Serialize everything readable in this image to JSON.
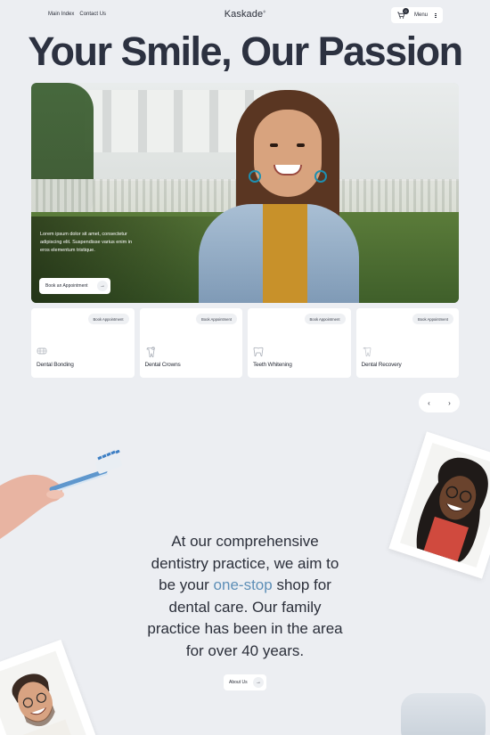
{
  "nav": {
    "links": [
      "Main Index",
      "Contact Us"
    ],
    "logo": "Kaskade",
    "cart_count": "0",
    "menu_label": "Menu"
  },
  "hero": {
    "title": "Your Smile, Our Passion",
    "text": "Lorem ipsum dolor sit amet, consectetur adipiscing elit. Suspendisse varius enim in eros elementum tristique.",
    "button": "Book an Appointment"
  },
  "services": [
    {
      "label": "Dental Bonding",
      "button": "Book Appointment",
      "icon": "tooth-bonding-icon"
    },
    {
      "label": "Dental Crowns",
      "button": "Book Appointment",
      "icon": "tooth-crown-icon"
    },
    {
      "label": "Teeth Whitening",
      "button": "Book Appointment",
      "icon": "tooth-whitening-icon"
    },
    {
      "label": "Dental Recovery",
      "button": "Book Appointment",
      "icon": "tooth-recovery-icon"
    }
  ],
  "pager": {
    "prev": "‹",
    "next": "›"
  },
  "mission": {
    "line1": "At our comprehensive",
    "line2": "dentistry practice, we aim to",
    "line3_pre": "be your ",
    "line3_accent": "one-stop",
    "line3_post": " shop for",
    "line4": "dental care. Our family",
    "line5": "practice has been in the area",
    "line6": "for over 40 years."
  },
  "about": {
    "button": "About Us"
  },
  "colors": {
    "background": "#eceef2",
    "accent": "#5e8fb7",
    "text": "#2b2f3a"
  }
}
